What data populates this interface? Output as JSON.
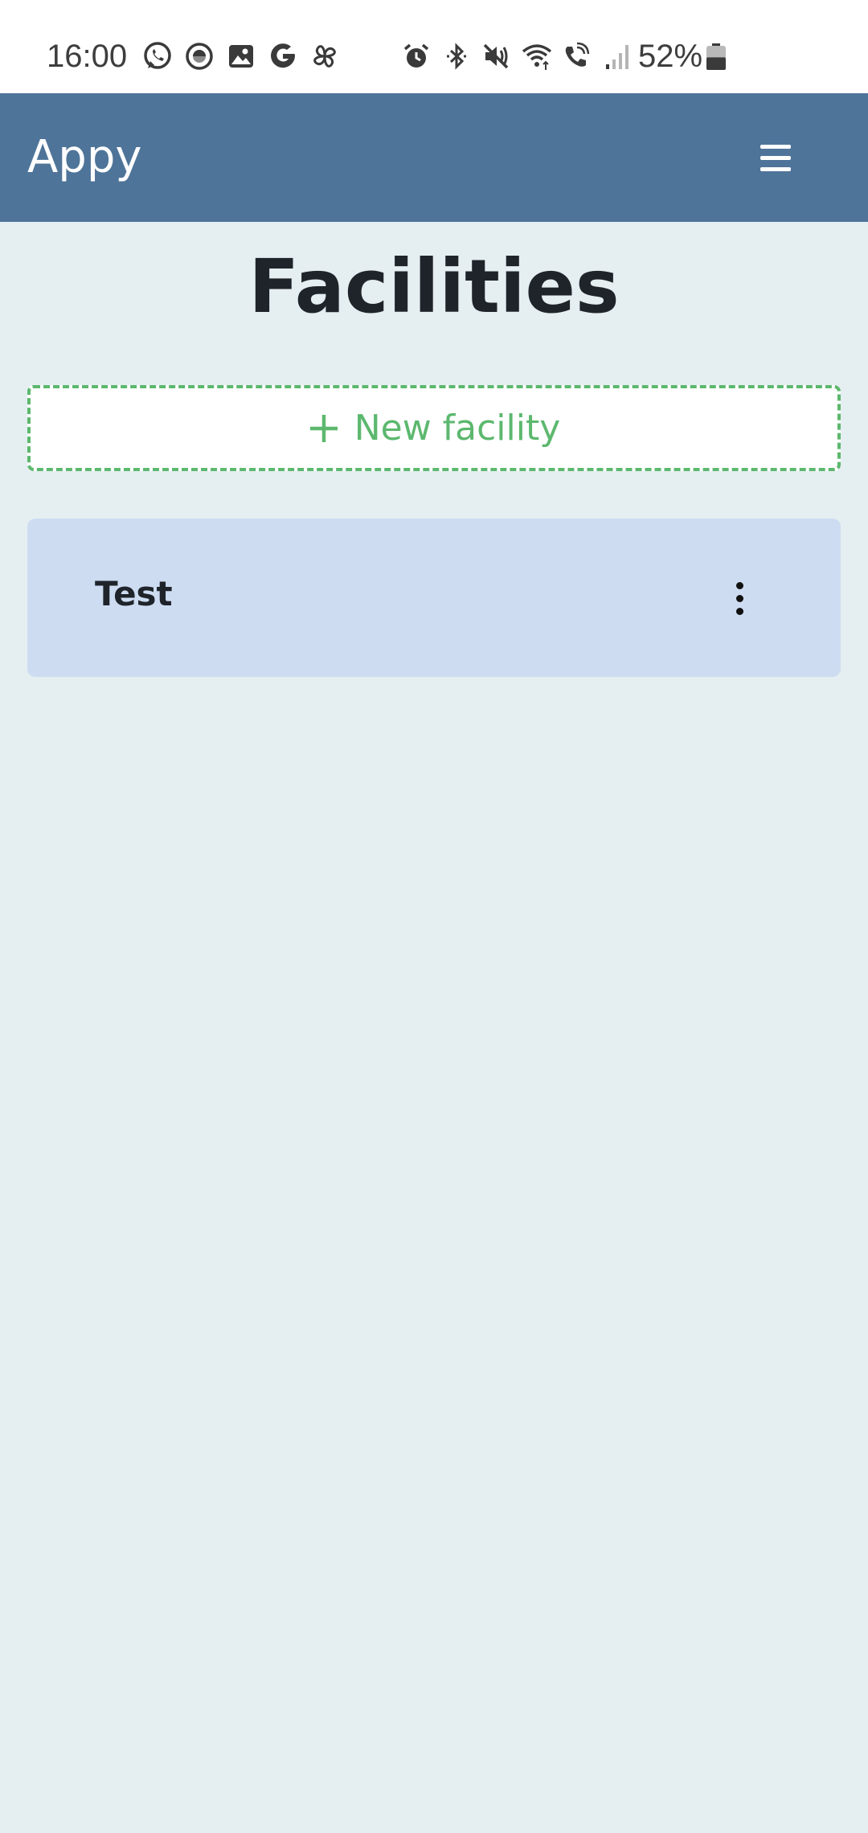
{
  "status_bar": {
    "time": "16:00",
    "battery_percent": "52%",
    "left_icons": [
      "whatsapp-icon",
      "messenger-icon",
      "gallery-icon",
      "google-icon",
      "pinwheel-icon"
    ],
    "right_icons": [
      "alarm-icon",
      "bluetooth-icon",
      "mute-icon",
      "wifi-icon",
      "wifi-calling-icon",
      "signal-icon"
    ],
    "battery_level": 0.52
  },
  "app_bar": {
    "title": "Appy",
    "menu_icon": "hamburger-menu-icon",
    "background_color": "#4f7499"
  },
  "main": {
    "page_title": "Facilities",
    "new_facility_button": {
      "label": "New facility",
      "icon": "plus-icon",
      "accent_color": "#5cb86e"
    },
    "facilities": [
      {
        "name": "Test",
        "menu_icon": "more-vertical-icon"
      }
    ]
  },
  "colors": {
    "page_background": "#e5eef1",
    "card_background": "#cddcf1",
    "text_primary": "#1f242a"
  }
}
